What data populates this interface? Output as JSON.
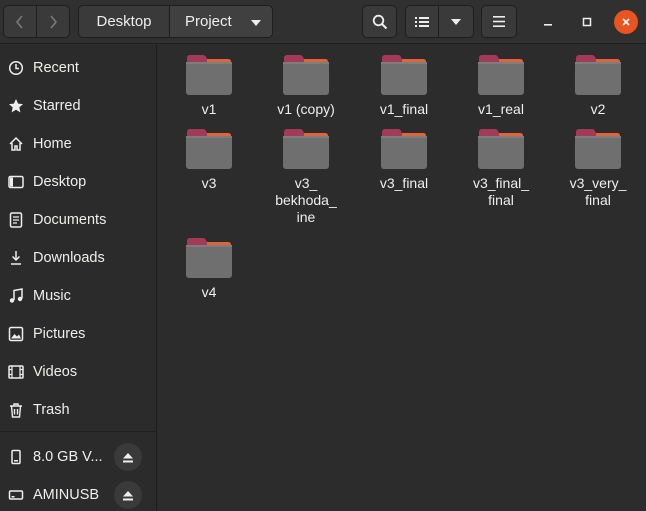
{
  "header": {
    "breadcrumb": [
      "Desktop",
      "Project"
    ]
  },
  "sidebar": {
    "places": [
      {
        "label": "Recent",
        "icon": "clock-icon"
      },
      {
        "label": "Starred",
        "icon": "star-icon"
      },
      {
        "label": "Home",
        "icon": "home-icon"
      },
      {
        "label": "Desktop",
        "icon": "desktop-icon"
      },
      {
        "label": "Documents",
        "icon": "documents-icon"
      },
      {
        "label": "Downloads",
        "icon": "download-icon"
      },
      {
        "label": "Music",
        "icon": "music-icon"
      },
      {
        "label": "Pictures",
        "icon": "pictures-icon"
      },
      {
        "label": "Videos",
        "icon": "videos-icon"
      },
      {
        "label": "Trash",
        "icon": "trash-icon"
      }
    ],
    "devices": [
      {
        "label": "8.0 GB V...",
        "icon": "drive-icon"
      },
      {
        "label": "AMINUSB",
        "icon": "usb-drive-icon"
      }
    ]
  },
  "files": [
    {
      "name": "v1"
    },
    {
      "name": "v1 (copy)"
    },
    {
      "name": "v1_final"
    },
    {
      "name": "v1_real"
    },
    {
      "name": "v2"
    },
    {
      "name": "v3"
    },
    {
      "name": "v3_\nbekhoda_\nine"
    },
    {
      "name": "v3_final"
    },
    {
      "name": "v3_final_\nfinal"
    },
    {
      "name": "v3_very_\nfinal"
    },
    {
      "name": "v4"
    }
  ],
  "colors": {
    "folder_tab": "#a33a58",
    "folder_tab_edge": "#e0643a",
    "folder_body": "#6f6f6f",
    "accent": "#e95420"
  }
}
